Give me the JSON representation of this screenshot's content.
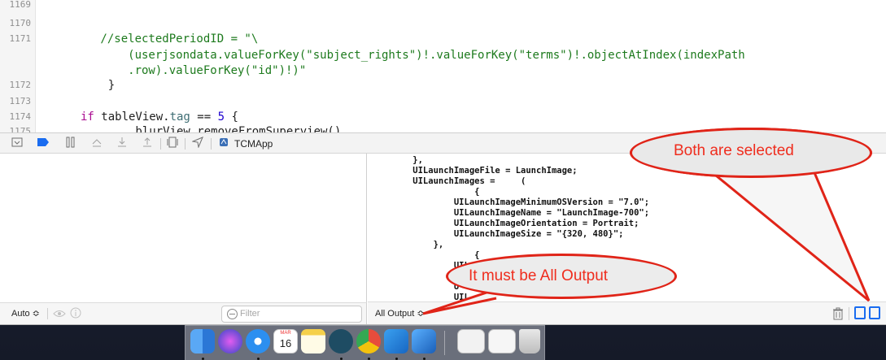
{
  "editor": {
    "lines": [
      {
        "num": "1169",
        "text": ""
      },
      {
        "num": "1170",
        "text": ""
      },
      {
        "num": "1171",
        "text": "        //selectedPeriodID = \"\\"
      },
      {
        "num": "",
        "text": "            (userjsondata.valueForKey(\"subject_rights\")!.valueForKey(\"terms\")!.objectAtIndex(indexPath"
      },
      {
        "num": "",
        "text": "            .row).valueForKey(\"id\")!)\""
      },
      {
        "num": "1172",
        "text": "    }"
      },
      {
        "num": "1173",
        "text": ""
      },
      {
        "num": "1174",
        "text": "    if tableView.tag == 5 {"
      },
      {
        "num": "1175",
        "text": "        blurView.removeFromSuperview()"
      }
    ]
  },
  "debug_bar": {
    "target_label": "TCMApp",
    "icons": [
      "hide-debug-area-icon",
      "breakpoints-icon",
      "pause-icon",
      "step-over-icon",
      "step-into-icon",
      "step-out-icon",
      "view-hierarchy-icon",
      "location-icon",
      "app-icon"
    ]
  },
  "console": {
    "text": "    },\n    UILaunchImageFile = LaunchImage;\n    UILaunchImages =     (\n                {\n            UILaunchImageMinimumOSVersion = \"7.0\";\n            UILaunchImageName = \"LaunchImage-700\";\n            UILaunchImageOrientation = Portrait;\n            UILaunchImageSize = \"{320, 480}\";\n        },\n                {\n            UILau\n            UI\n            U\n            UIL\n        }"
  },
  "variables_bar": {
    "scope_select": "Auto ≎",
    "filter_placeholder": "Filter"
  },
  "console_bar": {
    "output_select": "All Output ≎"
  },
  "callouts": {
    "top": "Both are selected",
    "bottom": "It must be All Output"
  },
  "colors": {
    "callout": "#e02418",
    "selected_toggle": "#1a6cf0"
  },
  "dock": {
    "calendar_month": "MAR",
    "calendar_day": "16"
  }
}
